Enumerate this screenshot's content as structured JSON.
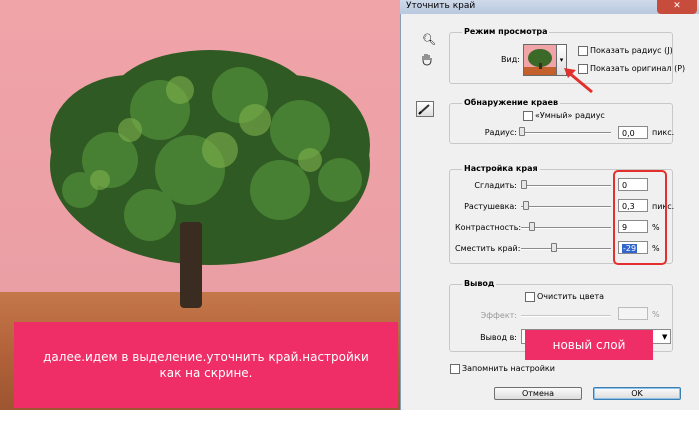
{
  "caption": "далее.идем в выделение.уточнить край.настройки как на скрине.",
  "dialog": {
    "title": "Уточнить край",
    "close_glyph": "✕",
    "view_mode": {
      "legend": "Режим просмотра",
      "view_label": "Вид:",
      "show_radius": "Показать радиус (J)",
      "show_original": "Показать оригинал (P)"
    },
    "edge_detection": {
      "legend": "Обнаружение краев",
      "smart_radius": "«Умный» радиус",
      "radius_label": "Радиус:",
      "radius_value": "0,0",
      "radius_unit": "пикс."
    },
    "edge_adjust": {
      "legend": "Настройка края",
      "smooth_label": "Сгладить:",
      "smooth_value": "0",
      "feather_label": "Растушевка:",
      "feather_value": "0,3",
      "feather_unit": "пикс.",
      "contrast_label": "Контрастность:",
      "contrast_value": "9",
      "contrast_unit": "%",
      "shift_label": "Сместить край:",
      "shift_value": "-29",
      "shift_unit": "%"
    },
    "output": {
      "legend": "Вывод",
      "decontaminate": "Очистить цвета",
      "effect_label": "Эффект:",
      "effect_unit": "%",
      "output_to_label": "Вывод в:",
      "output_to_value": "новый слой"
    },
    "remember": "Запомнить настройки",
    "cancel": "Отмена",
    "ok": "OK"
  },
  "colors": {
    "caption_bg": "#ef2d66",
    "highlight_box": "#e2302c",
    "arrow": "#e2302c"
  }
}
